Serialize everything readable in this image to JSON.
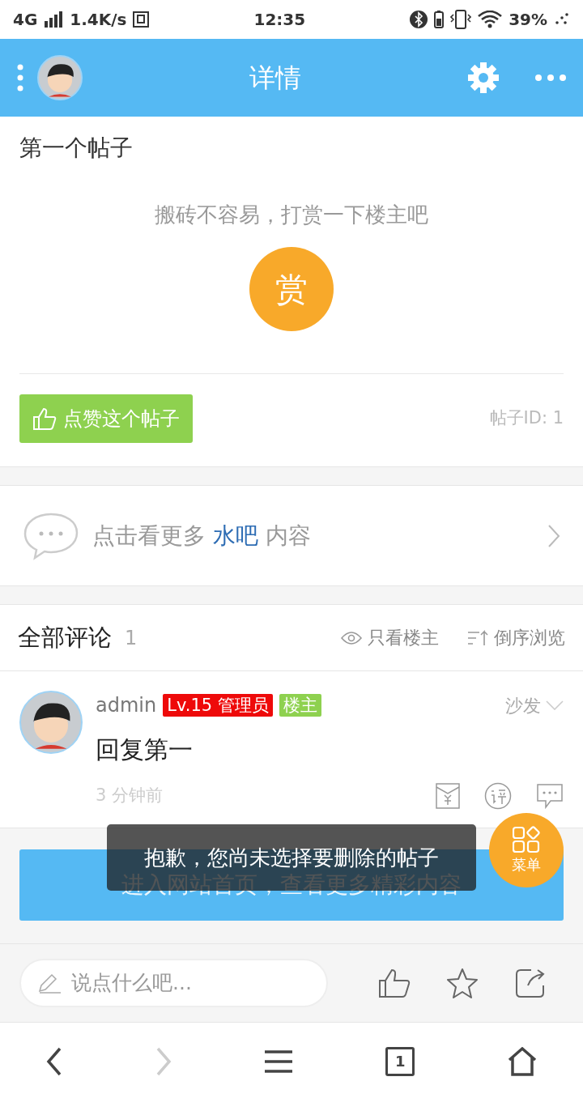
{
  "status_bar": {
    "network": "4G",
    "speed": "1.4K/s",
    "time": "12:35",
    "battery": "39%"
  },
  "header": {
    "title": "详情"
  },
  "post": {
    "title": "第一个帖子",
    "reward_prompt": "搬砖不容易，打赏一下楼主吧",
    "reward_button": "赏",
    "like_button": "点赞这个帖子",
    "post_id": "帖子ID: 1"
  },
  "forum_link": {
    "prefix": "点击看更多",
    "forum": "水吧",
    "suffix": "内容"
  },
  "comments": {
    "title": "全部评论",
    "count": "1",
    "filters": [
      {
        "kind": "author",
        "label": "只看楼主"
      },
      {
        "kind": "reverse",
        "label": "倒序浏览"
      }
    ],
    "items": [
      {
        "author": "admin",
        "badges": [
          {
            "text": "Lv.15 管理员",
            "color": "#ee0a0a"
          },
          {
            "text": "楼主",
            "color": "#8ed14f"
          }
        ],
        "floor": "沙发",
        "content": "回复第一",
        "time": "3 分钟前"
      }
    ]
  },
  "home_button": "进入网站首页，查看更多精彩内容",
  "toast": "抱歉，您尚未选择要删除的帖子",
  "fab": {
    "label": "菜单"
  },
  "reply_bar": {
    "placeholder": "说点什么吧..."
  },
  "browser_nav": [
    {
      "kind": "back",
      "disabled": false
    },
    {
      "kind": "forward",
      "disabled": true
    },
    {
      "kind": "menu",
      "disabled": false
    },
    {
      "kind": "tabs",
      "count": "1",
      "disabled": false
    },
    {
      "kind": "home",
      "disabled": false
    }
  ]
}
